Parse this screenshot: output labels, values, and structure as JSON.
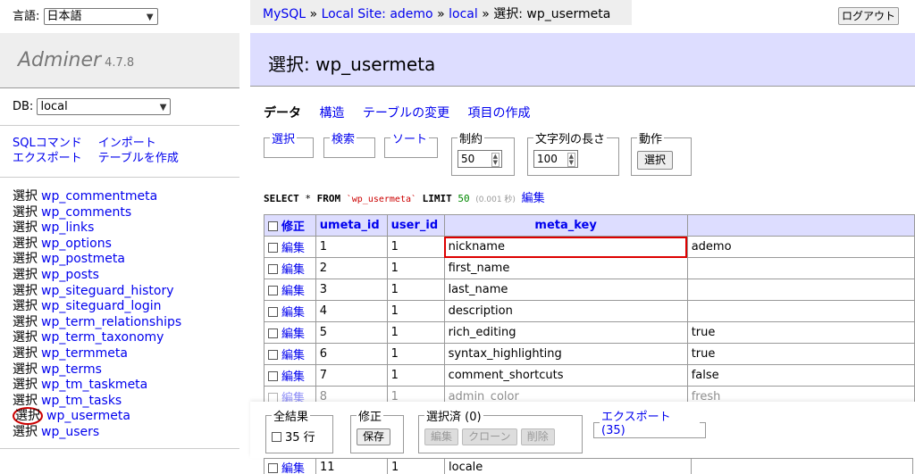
{
  "sidebar": {
    "lang_label": "言語:",
    "lang_value": "日本語",
    "app_name": "Adminer",
    "version": "4.7.8",
    "db_label": "DB:",
    "db_value": "local",
    "sql_command": "SQLコマンド",
    "import": "インポート",
    "export": "エクスポート",
    "create_table": "テーブルを作成",
    "select_word": "選択",
    "tables": [
      "wp_commentmeta",
      "wp_comments",
      "wp_links",
      "wp_options",
      "wp_postmeta",
      "wp_posts",
      "wp_siteguard_history",
      "wp_siteguard_login",
      "wp_term_relationships",
      "wp_term_taxonomy",
      "wp_termmeta",
      "wp_terms",
      "wp_tm_taskmeta",
      "wp_tm_tasks",
      "wp_usermeta",
      "wp_users"
    ]
  },
  "breadcrumb": {
    "mysql": "MySQL",
    "site": "Local Site: ademo",
    "db": "local",
    "sep": "»",
    "current": "選択: wp_usermeta"
  },
  "logout": "ログアウト",
  "page_title": "選択: wp_usermeta",
  "tabs": {
    "data": "データ",
    "structure": "構造",
    "alter": "テーブルの変更",
    "new_item": "項目の作成"
  },
  "filters": {
    "select": "選択",
    "search": "検索",
    "sort": "ソート",
    "limit_label": "制約",
    "limit_value": "50",
    "textlen_label": "文字列の長さ",
    "textlen_value": "100",
    "action_label": "動作",
    "action_button": "選択"
  },
  "sql": {
    "select": "SELECT",
    "star": "*",
    "from": "FROM",
    "table": "`wp_usermeta`",
    "limit": "LIMIT",
    "limit_num": "50",
    "time": "(0.001 秒)",
    "edit": "編集"
  },
  "table": {
    "headers": {
      "modify": "修正",
      "umeta_id": "umeta_id",
      "user_id": "user_id",
      "meta_key": "meta_key",
      "meta_value": ""
    },
    "edit_label": "編集",
    "rows": [
      {
        "umeta_id": "1",
        "user_id": "1",
        "meta_key": "nickname",
        "meta_value": "ademo"
      },
      {
        "umeta_id": "2",
        "user_id": "1",
        "meta_key": "first_name",
        "meta_value": ""
      },
      {
        "umeta_id": "3",
        "user_id": "1",
        "meta_key": "last_name",
        "meta_value": ""
      },
      {
        "umeta_id": "4",
        "user_id": "1",
        "meta_key": "description",
        "meta_value": ""
      },
      {
        "umeta_id": "5",
        "user_id": "1",
        "meta_key": "rich_editing",
        "meta_value": "true"
      },
      {
        "umeta_id": "6",
        "user_id": "1",
        "meta_key": "syntax_highlighting",
        "meta_value": "true"
      },
      {
        "umeta_id": "7",
        "user_id": "1",
        "meta_key": "comment_shortcuts",
        "meta_value": "false"
      },
      {
        "umeta_id": "8",
        "user_id": "1",
        "meta_key": "admin_color",
        "meta_value": "fresh"
      }
    ],
    "after_row": {
      "umeta_id": "11",
      "user_id": "1",
      "meta_key": "locale"
    }
  },
  "footer": {
    "all_results": "全結果",
    "rows_count": "35 行",
    "modify": "修正",
    "save": "保存",
    "selected": "選択済 (0)",
    "edit": "編集",
    "clone": "クローン",
    "delete": "削除",
    "export": "エクスポート (35)"
  }
}
